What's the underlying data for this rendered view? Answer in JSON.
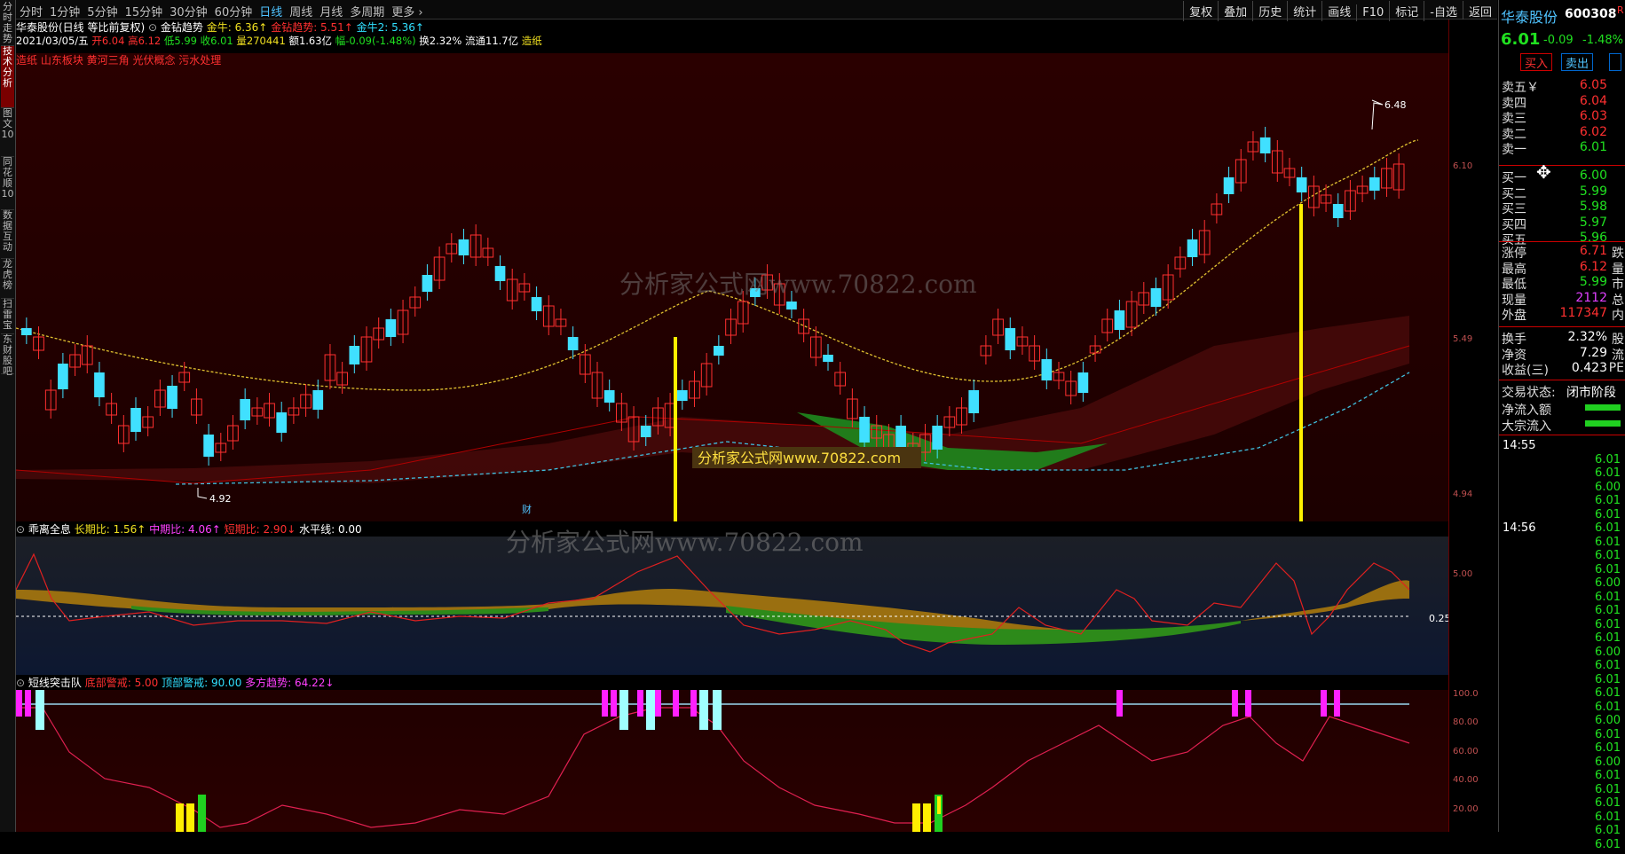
{
  "left_tabs": [
    "分时走势",
    "技术分析",
    "图文10",
    "同花顺10",
    "数据互动",
    "龙虎榜",
    "扫雷宝",
    "东财股吧"
  ],
  "periods": [
    "分时",
    "1分钟",
    "5分钟",
    "15分钟",
    "30分钟",
    "60分钟",
    "日线",
    "周线",
    "月线",
    "多周期",
    "更多 ›"
  ],
  "active_period": "日线",
  "top_buttons": [
    "复权",
    "叠加",
    "历史",
    "统计",
    "画线",
    "F10",
    "标记",
    "-自选",
    "返回"
  ],
  "info": {
    "title": "华泰股份(日线 等比前复权)",
    "indicator": "金钻趋势",
    "items": [
      {
        "label": "金牛: ",
        "value": "6.36",
        "color": "#f0e020"
      },
      {
        "label": "金钻趋势: ",
        "value": "5.51",
        "color": "#ff3030"
      },
      {
        "label": "金牛2: ",
        "value": "5.36",
        "color": "#30e0ff"
      }
    ]
  },
  "quote": {
    "date": "2021/03/05/五",
    "open": "开6.04",
    "high": "高6.12",
    "low": "低5.99",
    "close": "收6.01",
    "vol": "量270441",
    "amt": "额1.63亿",
    "change": "幅-0.09(-1.48%)",
    "turnover": "换2.32%",
    "float": "流通11.7亿",
    "tag": "造纸"
  },
  "notes": "造纸 山东板块 黄河三角 光伏概念 污水处理",
  "chart": {
    "high_label": "6.48",
    "low_label": "4.92",
    "watermark1": "分析家公式网www.70822.com",
    "watermark2": "分析家公式网www.70822.com",
    "watermark3": "分析家公式网www.70822.com",
    "cai": "财"
  },
  "price_axis": [
    "6.10",
    "5.49",
    "4.94"
  ],
  "ind1": {
    "name": "乖离全息",
    "items": [
      {
        "label": "长期比: ",
        "value": "1.56",
        "arrow": "↑",
        "color": "#f0e020"
      },
      {
        "label": "中期比: ",
        "value": "4.06",
        "arrow": "↑",
        "color": "#ff40ff"
      },
      {
        "label": "短期比: ",
        "value": "2.90",
        "arrow": "↓",
        "color": "#ff3030"
      },
      {
        "label": "水平线: ",
        "value": "0.00",
        "arrow": "",
        "color": "#ffffff"
      }
    ],
    "axis": [
      "5.00"
    ],
    "badge": "0.25"
  },
  "ind2": {
    "name": "短线突击队",
    "items": [
      {
        "label": "底部警戒: ",
        "value": "5.00",
        "color": "#ff3030"
      },
      {
        "label": "顶部警戒: ",
        "value": "90.00",
        "color": "#30e0ff"
      },
      {
        "label": "多方趋势: ",
        "value": "64.22",
        "arrow": "↓",
        "color": "#ff40ff"
      }
    ],
    "axis": [
      "100.0",
      "80.00",
      "60.00",
      "40.00",
      "20.00"
    ]
  },
  "side": {
    "name": "华泰股份",
    "code": "600308",
    "mark": "R",
    "price": "6.01",
    "change": "-0.09",
    "pct": "-1.48%",
    "buy_label": "买入",
    "sell_label": "卖出",
    "asks": [
      {
        "l": "卖五￥",
        "v": "6.05"
      },
      {
        "l": "卖四",
        "v": "6.04"
      },
      {
        "l": "卖三",
        "v": "6.03"
      },
      {
        "l": "卖二",
        "v": "6.02"
      },
      {
        "l": "卖一",
        "v": "6.01"
      }
    ],
    "bids": [
      {
        "l": "买一",
        "v": "6.00"
      },
      {
        "l": "买二",
        "v": "5.99"
      },
      {
        "l": "买三",
        "v": "5.98"
      },
      {
        "l": "买四",
        "v": "5.97"
      },
      {
        "l": "买五",
        "v": "5.96"
      }
    ],
    "stats": [
      {
        "l": "涨停",
        "v": "6.71",
        "r": "跌",
        "c": "#ff3030"
      },
      {
        "l": "最高",
        "v": "6.12",
        "r": "量",
        "c": "#ff3030"
      },
      {
        "l": "最低",
        "v": "5.99",
        "r": "市",
        "c": "#20e020"
      },
      {
        "l": "现量",
        "v": "2112",
        "r": "总",
        "c": "#e040ff"
      },
      {
        "l": "外盘",
        "v": "117347",
        "r": "内",
        "c": "#ff3030"
      }
    ],
    "stats2": [
      {
        "l": "换手",
        "v": "2.32%",
        "r": "股"
      },
      {
        "l": "净资",
        "v": "7.29",
        "r": "流"
      },
      {
        "l": "收益(三)",
        "v": "0.423",
        "r": "PE"
      }
    ],
    "trade_state_label": "交易状态:",
    "trade_state": "闭市阶段",
    "net_in": "净流入额",
    "big_in": "大宗流入",
    "t1": "14:55",
    "t2": "14:56",
    "tick_price": "6.01",
    "tick_price2": "6.00"
  }
}
